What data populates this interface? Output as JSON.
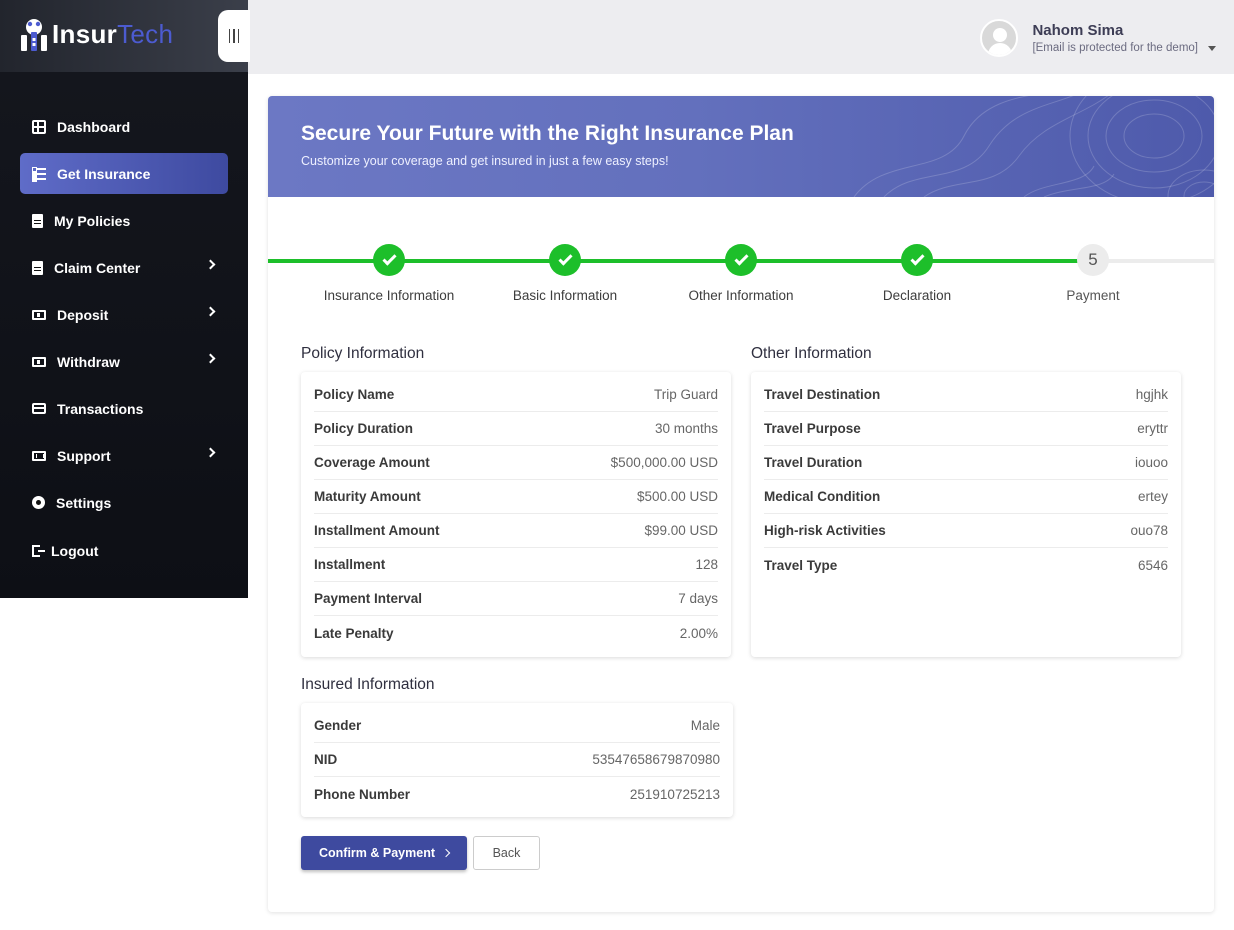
{
  "brand": {
    "name_part1": "Insur",
    "name_part2": "Tech"
  },
  "user": {
    "name": "Nahom Sima",
    "email": "[Email is protected for the demo]"
  },
  "sidebar": {
    "items": [
      {
        "label": "Dashboard",
        "icon": "grid-icon",
        "has_submenu": false,
        "active": false
      },
      {
        "label": "Get Insurance",
        "icon": "list-check-icon",
        "has_submenu": false,
        "active": true
      },
      {
        "label": "My Policies",
        "icon": "document-icon",
        "has_submenu": false,
        "active": false
      },
      {
        "label": "Claim Center",
        "icon": "invoice-icon",
        "has_submenu": true,
        "active": false
      },
      {
        "label": "Deposit",
        "icon": "cash-icon",
        "has_submenu": true,
        "active": false
      },
      {
        "label": "Withdraw",
        "icon": "money-icon",
        "has_submenu": true,
        "active": false
      },
      {
        "label": "Transactions",
        "icon": "credit-card-icon",
        "has_submenu": false,
        "active": false
      },
      {
        "label": "Support",
        "icon": "ticket-icon",
        "has_submenu": true,
        "active": false
      },
      {
        "label": "Settings",
        "icon": "gear-icon",
        "has_submenu": false,
        "active": false
      },
      {
        "label": "Logout",
        "icon": "logout-icon",
        "has_submenu": false,
        "active": false
      }
    ]
  },
  "banner": {
    "title": "Secure Your Future with the Right Insurance Plan",
    "subtitle": "Customize your coverage and get insured in just a few easy steps!"
  },
  "stepper": {
    "steps": [
      {
        "label": "Insurance Information",
        "status": "done"
      },
      {
        "label": "Basic Information",
        "status": "done"
      },
      {
        "label": "Other Information",
        "status": "done"
      },
      {
        "label": "Declaration",
        "status": "done"
      },
      {
        "label": "Payment",
        "status": "current",
        "number": "5"
      }
    ],
    "complete_color": "#1dbf2a",
    "pending_color": "#ececec"
  },
  "policy_info": {
    "title": "Policy Information",
    "rows": [
      {
        "label": "Policy Name",
        "value": "Trip Guard"
      },
      {
        "label": "Policy Duration",
        "value": "30 months"
      },
      {
        "label": "Coverage Amount",
        "value": "$500,000.00 USD"
      },
      {
        "label": "Maturity Amount",
        "value": "$500.00 USD"
      },
      {
        "label": "Installment Amount",
        "value": "$99.00 USD"
      },
      {
        "label": "Installment",
        "value": "128"
      },
      {
        "label": "Payment Interval",
        "value": "7 days"
      },
      {
        "label": "Late Penalty",
        "value": "2.00%"
      }
    ]
  },
  "other_info": {
    "title": "Other Information",
    "rows": [
      {
        "label": "Travel Destination",
        "value": "hgjhk"
      },
      {
        "label": "Travel Purpose",
        "value": "eryttr"
      },
      {
        "label": "Travel Duration",
        "value": "iouoo"
      },
      {
        "label": "Medical Condition",
        "value": "ertey"
      },
      {
        "label": "High-risk Activities",
        "value": "ouo78"
      },
      {
        "label": "Travel Type",
        "value": "6546"
      }
    ]
  },
  "insured_info": {
    "title": "Insured Information",
    "rows": [
      {
        "label": "Gender",
        "value": "Male"
      },
      {
        "label": "NID",
        "value": "53547658679870980"
      },
      {
        "label": "Phone Number",
        "value": "251910725213"
      }
    ]
  },
  "actions": {
    "confirm_label": "Confirm & Payment",
    "back_label": "Back"
  },
  "colors": {
    "primary": "#3e4a9f",
    "accent": "#6c78c4",
    "sidebar_bg": "#14161d",
    "success": "#1dbf2a"
  }
}
